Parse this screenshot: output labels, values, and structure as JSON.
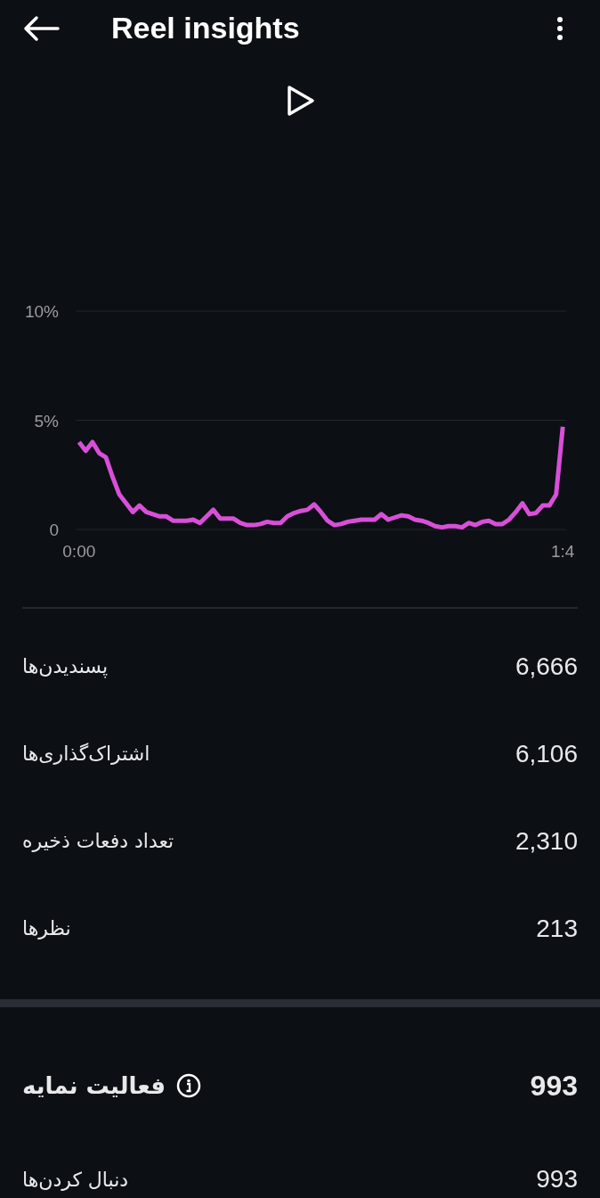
{
  "header": {
    "title": "Reel insights"
  },
  "chart": {
    "chart_data": {
      "type": "line",
      "ylim": [
        0,
        10
      ],
      "yticks": [
        {
          "value": 0,
          "label": "0"
        },
        {
          "value": 5,
          "label": "5%"
        },
        {
          "value": 10,
          "label": "10%"
        }
      ],
      "categories": [
        "0:00",
        null,
        null,
        null,
        null,
        null,
        null,
        null,
        null,
        null,
        null,
        null,
        null,
        null,
        null,
        null,
        null,
        null,
        null,
        null,
        null,
        null,
        null,
        null,
        null,
        null,
        null,
        null,
        null,
        null,
        null,
        null,
        null,
        null,
        null,
        null,
        null,
        null,
        null,
        null,
        null,
        null,
        null,
        null,
        null,
        null,
        null,
        null,
        null,
        null,
        null,
        null,
        null,
        null,
        null,
        null,
        null,
        null,
        null,
        null,
        null,
        null,
        null,
        null,
        null,
        null,
        null,
        null,
        null,
        null,
        null,
        null,
        "1:4"
      ],
      "series": [
        {
          "color": "#d84fd8",
          "values": [
            4.0,
            3.6,
            4.0,
            3.5,
            3.3,
            2.4,
            1.6,
            1.2,
            0.8,
            1.1,
            0.8,
            0.7,
            0.6,
            0.6,
            0.4,
            0.4,
            0.4,
            0.45,
            0.3,
            0.6,
            0.9,
            0.5,
            0.5,
            0.5,
            0.3,
            0.2,
            0.2,
            0.25,
            0.35,
            0.3,
            0.3,
            0.6,
            0.75,
            0.85,
            0.9,
            1.15,
            0.8,
            0.4,
            0.2,
            0.25,
            0.35,
            0.4,
            0.45,
            0.45,
            0.45,
            0.7,
            0.45,
            0.55,
            0.65,
            0.6,
            0.45,
            0.4,
            0.3,
            0.15,
            0.1,
            0.15,
            0.15,
            0.1,
            0.3,
            0.2,
            0.35,
            0.4,
            0.25,
            0.25,
            0.45,
            0.8,
            1.2,
            0.7,
            0.75,
            1.1,
            1.1,
            1.6,
            4.7
          ]
        }
      ]
    }
  },
  "metrics": [
    {
      "label": "پسندیدن‌ها",
      "value": "6,666"
    },
    {
      "label": "اشتراک‌گذاری‌ها",
      "value": "6,106"
    },
    {
      "label": "تعداد دفعات ذخیره",
      "value": "2,310"
    },
    {
      "label": "نظرها",
      "value": "213"
    }
  ],
  "profile_activity": {
    "title": "فعالیت نمایه",
    "total": "993",
    "rows": [
      {
        "label": "دنبال کردن‌ها",
        "value": "993"
      }
    ]
  }
}
